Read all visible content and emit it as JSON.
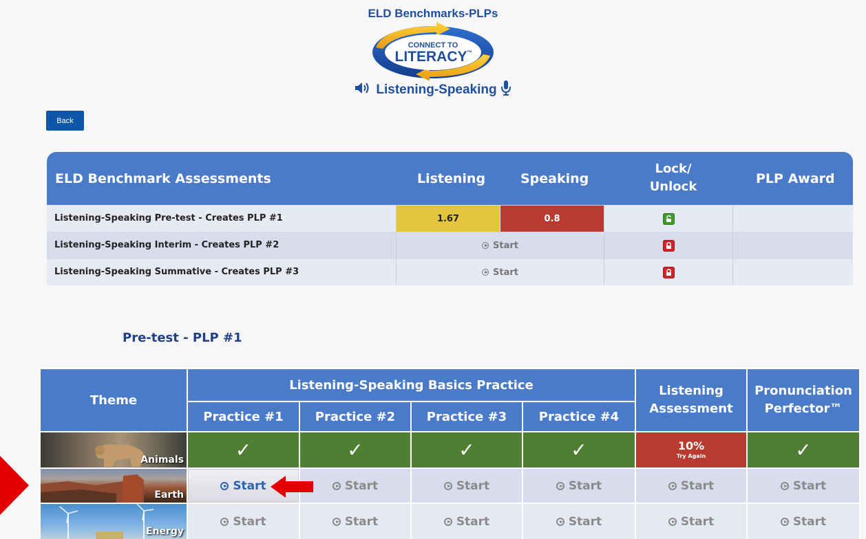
{
  "header": {
    "title": "ELD Benchmarks-PLPs",
    "logo_line1": "CONNECT TO",
    "logo_line2": "LITERACY",
    "logo_tm": "™",
    "subtitle": "Listening-Speaking"
  },
  "back_label": "Back",
  "assessments": {
    "headers": {
      "title": "ELD Benchmark Assessments",
      "listening": "Listening",
      "speaking": "Speaking",
      "lock": "Lock/\nUnlock",
      "award": "PLP Award"
    },
    "rows": [
      {
        "name": "Listening-Speaking Pre-test - Creates PLP #1",
        "listening": "1.67",
        "speaking": "0.8",
        "lock": "unlocked",
        "award": ""
      },
      {
        "name": "Listening-Speaking Interim - Creates PLP #2",
        "start": "Start",
        "lock": "locked",
        "award": ""
      },
      {
        "name": "Listening-Speaking Summative - Creates PLP #3",
        "start": "Start",
        "lock": "locked",
        "award": ""
      }
    ]
  },
  "section_title": "Pre-test - PLP #1",
  "practice": {
    "headers": {
      "theme": "Theme",
      "group": "Listening-Speaking Basics Practice",
      "p1": "Practice #1",
      "p2": "Practice #2",
      "p3": "Practice #3",
      "p4": "Practice #4",
      "assessment_l1": "Listening",
      "assessment_l2": "Assessment",
      "perfector_l1": "Pronunciation",
      "perfector_l2": "Perfector™"
    },
    "rows": [
      {
        "theme": "Animals",
        "checkmark": "✓",
        "assessment_pct": "10%",
        "assessment_note": "Try Again"
      },
      {
        "theme": "Earth",
        "start": "Start"
      },
      {
        "theme": "Energy",
        "start": "Start"
      }
    ]
  },
  "colors": {
    "header_blue": "#4a7bc8",
    "complete_green": "#4f7f33",
    "fail_red": "#b83a30",
    "listening_yellow": "#e2c53c",
    "title_blue": "#1f3f88"
  }
}
